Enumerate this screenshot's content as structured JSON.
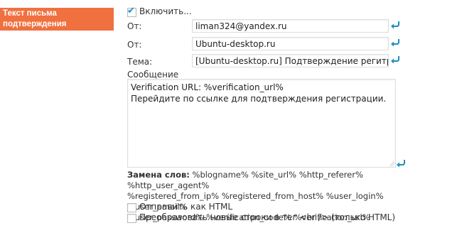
{
  "section": {
    "title": "Текст письма подтверждения"
  },
  "enable": {
    "label": "Включить...",
    "checked": true
  },
  "from_email": {
    "label": "От:",
    "value": "liman324@yandex.ru"
  },
  "from_name": {
    "label": "От:",
    "value": "Ubuntu-desktop.ru"
  },
  "subject": {
    "label": "Тема:",
    "value": "[Ubuntu-desktop.ru] Подтверждение регитрации"
  },
  "message": {
    "label": "Сообщение",
    "line1": "Verification URL: %verification_url%",
    "line2": "Перейдите по ссылке для подтверждения регистрации."
  },
  "substitutions": {
    "title": "Замена слов:",
    "line1": " %blogname% %site_url% %http_referer% %http_user_agent%",
    "line2": "%registered_from_ip% %registered_from_host% %user_login% %user_email%",
    "line3": "%user_password% %verification_code% %verification_url%"
  },
  "send_html": {
    "label": "Отправить как HTML",
    "checked": false
  },
  "convert_br": {
    "label": "Преобразовать новые строки в тег <br /> (только HTML)",
    "checked": false
  },
  "colors": {
    "accent": "#f0703f",
    "link_blue": "#1e8cbe"
  },
  "icons": {
    "reset": "reset-arrow-icon",
    "check": "checkmark-icon"
  }
}
